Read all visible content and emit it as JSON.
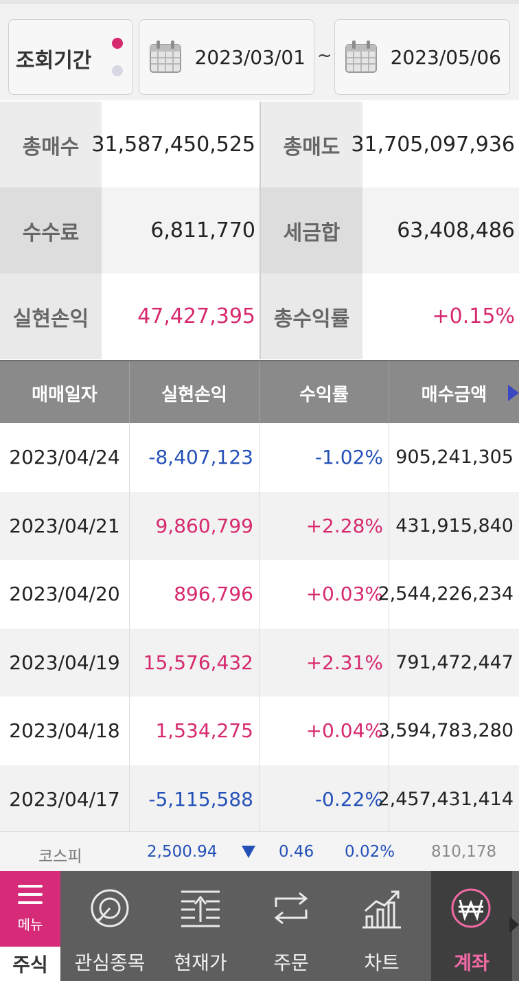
{
  "period": {
    "label": "조회기간",
    "start_date": "2023/03/01",
    "separator": "~",
    "end_date": "2023/05/06",
    "dot_active_color": "#d6296e",
    "dot_inactive_color": "#d8d8e4"
  },
  "summary": {
    "total_buy_label": "총매수",
    "total_buy_value": "31,587,450,525",
    "total_sell_label": "총매도",
    "total_sell_value": "31,705,097,936",
    "fee_label": "수수료",
    "fee_value": "6,811,770",
    "tax_label": "세금합",
    "tax_value": "63,408,486",
    "realized_pl_label": "실현손익",
    "realized_pl_value": "47,427,395",
    "total_return_label": "총수익률",
    "total_return_value": "+0.15%"
  },
  "table": {
    "headers": [
      "매매일자",
      "실현손익",
      "수익률",
      "매수금액"
    ],
    "rows": [
      {
        "date": "2023/04/24",
        "pl": "-8,407,123",
        "rate": "-1.02%",
        "buy_amount": "905,241,305",
        "sign": "neg"
      },
      {
        "date": "2023/04/21",
        "pl": "9,860,799",
        "rate": "+2.28%",
        "buy_amount": "431,915,840",
        "sign": "pos"
      },
      {
        "date": "2023/04/20",
        "pl": "896,796",
        "rate": "+0.03%",
        "buy_amount": "2,544,226,234",
        "sign": "pos"
      },
      {
        "date": "2023/04/19",
        "pl": "15,576,432",
        "rate": "+2.31%",
        "buy_amount": "791,472,447",
        "sign": "pos"
      },
      {
        "date": "2023/04/18",
        "pl": "1,534,275",
        "rate": "+0.04%",
        "buy_amount": "3,594,783,280",
        "sign": "pos"
      },
      {
        "date": "2023/04/17",
        "pl": "-5,115,588",
        "rate": "-0.22%",
        "buy_amount": "2,457,431,414",
        "sign": "neg"
      }
    ]
  },
  "ticker": {
    "name": "코스피",
    "price": "2,500.94",
    "change": "0.46",
    "rate": "0.02%",
    "volume": "810,178"
  },
  "nav": {
    "menu_label": "메뉴",
    "stock_label": "주식",
    "items": [
      {
        "label": "관심종목",
        "icon": "target-icon"
      },
      {
        "label": "현재가",
        "icon": "price-lines-icon"
      },
      {
        "label": "주문",
        "icon": "exchange-arrows-icon"
      },
      {
        "label": "차트",
        "icon": "chart-icon"
      },
      {
        "label": "계좌",
        "icon": "won-icon",
        "active": true
      }
    ]
  },
  "colors": {
    "positive": "#d6296e",
    "negative": "#2451b8",
    "menu_bg": "#d52b78",
    "nav_bg": "#5e5e5e"
  }
}
